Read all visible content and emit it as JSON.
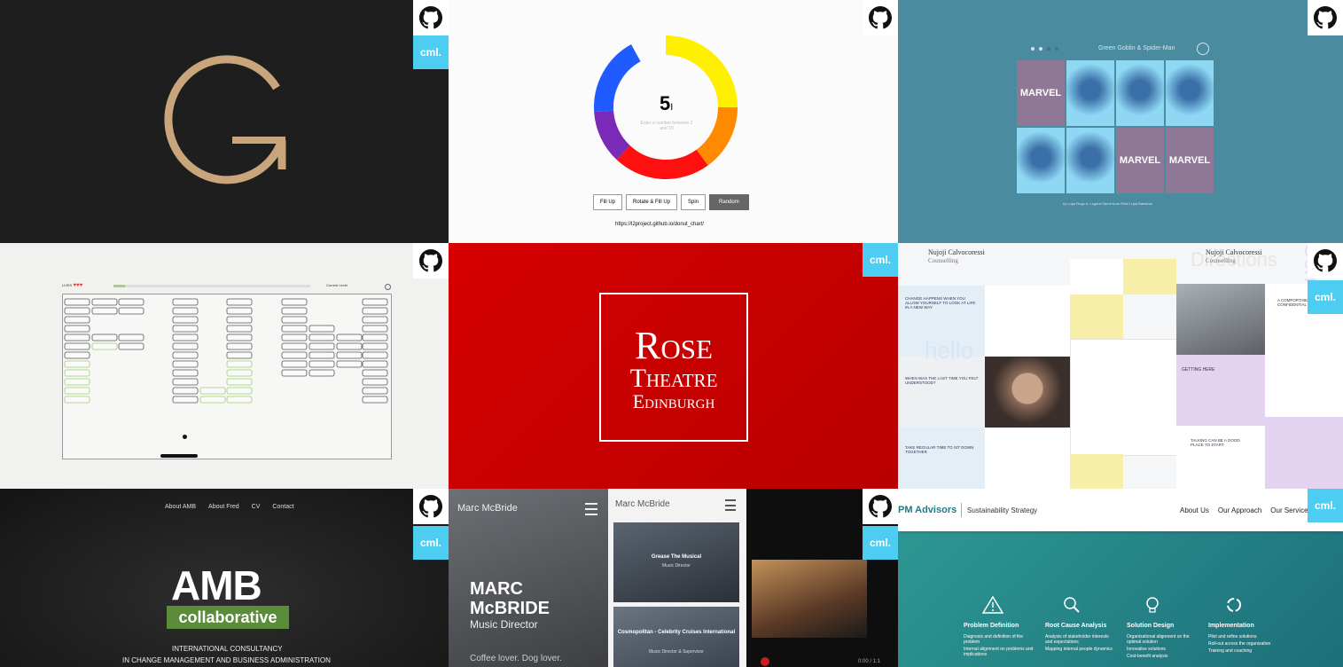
{
  "tile_badge": "cml.",
  "tiles": {
    "g_logo": {
      "letter": "G"
    },
    "donut": {
      "value": "5",
      "cursor": "I",
      "hint": "Enter a number between 2 and 10",
      "buttons": [
        "Fill Up",
        "Rotate & Fill Up",
        "Spin",
        "Random"
      ],
      "url": "https://l2project.github.io/donut_chart/",
      "segments": [
        {
          "color": "#ffef00",
          "pct": 0.25
        },
        {
          "color": "#ff8a00",
          "pct": 0.15
        },
        {
          "color": "#ff1010",
          "pct": 0.22
        },
        {
          "color": "#7b2ab8",
          "pct": 0.12
        },
        {
          "color": "#1f5bff",
          "pct": 0.18
        }
      ]
    },
    "marvel": {
      "title": "Green Goblin & Spider-Man",
      "card_text": "MARVEL",
      "footer": "by Lupa Rugs A. Lugard Game from Rishi Lupa Babalola"
    },
    "game": {
      "lives_label": "LIVES",
      "level_label": "Current Level"
    },
    "rose": {
      "line1": "Rose",
      "line2": "Theatre",
      "line3": "Edinburgh"
    },
    "calvo": {
      "name": "Nujoji Calvocoressi",
      "sub": "Counselling",
      "bg_words": [
        "Welcome",
        "hello",
        "Contact",
        "Directions"
      ],
      "headline1": "CHANGE HAPPENS WHEN YOU ALLOW YOURSELF TO LOOK AT LIFE IN A NEW WAY",
      "headline2": "WHEN WAS THE LAST TIME YOU FELT UNDERSTOOD?",
      "headline3": "TAKE REGULAR TIME TO SIT DOWN TOGETHER",
      "headline4": "A COMFORTABLE, CONFIDENTIAL PLACE",
      "headline5": "GETTING HERE",
      "headline6": "TALKING CAN BE A GOOD PLACE TO START"
    },
    "amb": {
      "nav": [
        "About AMB",
        "About Fred",
        "CV",
        "Contact"
      ],
      "logo": "AMB",
      "sub": "collaborative",
      "tag1": "INTERNATIONAL CONSULTANCY",
      "tag2": "IN CHANGE MANAGEMENT AND BUSINESS ADMINISTRATION"
    },
    "mcbride": {
      "brand": "Marc McBride",
      "name1": "MARC",
      "name2": "McBRIDE",
      "role": "Music Director",
      "tagline": "Coffee lover. Dog lover.",
      "card1_title": "Grease The Musical",
      "card1_sub": "Music Director",
      "card2_title": "Cosmopolitan - Celebrity Cruises International",
      "card2_sub": "Music Director & Supervisor",
      "time": "0:00 / 1:1"
    },
    "pm": {
      "brand": "PM Advisors",
      "tagline": "Sustainability Strategy",
      "nav": [
        "About Us",
        "Our Approach",
        "Our Services"
      ],
      "cols": [
        {
          "title": "Problem Definition",
          "lines": [
            "Diagnosis and definition of the problem",
            "Internal alignment on problems and implications"
          ]
        },
        {
          "title": "Root Cause Analysis",
          "lines": [
            "Analysis of stakeholder interests and expectations",
            "Mapping internal people dynamics"
          ]
        },
        {
          "title": "Solution Design",
          "lines": [
            "Organizational alignment on the optimal solution",
            "Innovative solutions",
            "Cost-benefit analysis"
          ]
        },
        {
          "title": "Implementation",
          "lines": [
            "Pilot and refine solutions",
            "Roll-out across the organization",
            "Training and coaching"
          ]
        }
      ]
    }
  }
}
